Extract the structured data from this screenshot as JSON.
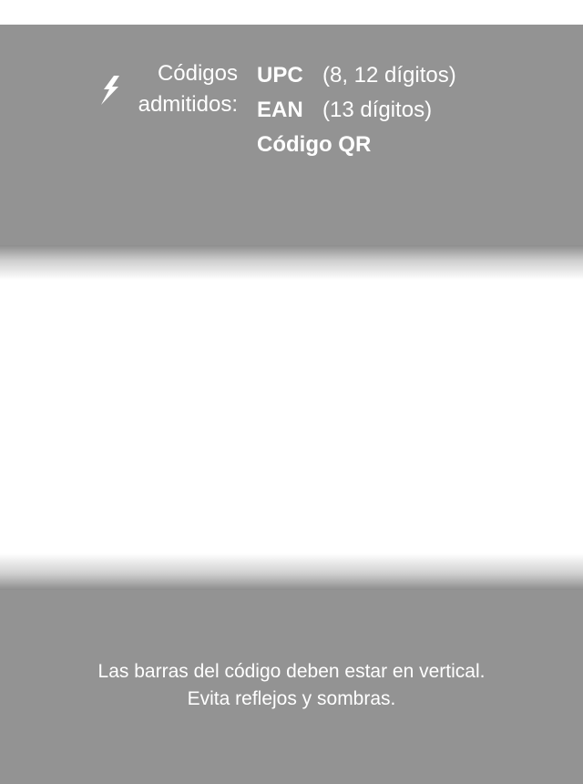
{
  "header": {
    "label_line1": "Códigos",
    "label_line2": "admitidos:",
    "codes": [
      {
        "name": "UPC",
        "detail": "(8, 12 dígitos)"
      },
      {
        "name": "EAN",
        "detail": "(13 dígitos)"
      },
      {
        "name": "Código QR",
        "detail": ""
      }
    ],
    "icon": "flash-icon"
  },
  "footer": {
    "line1": "Las barras del código deben estar en vertical.",
    "line2": "Evita reflejos y sombras."
  },
  "colors": {
    "overlay": "#939393",
    "text": "#ffffff",
    "scan_window": "#ffffff"
  }
}
